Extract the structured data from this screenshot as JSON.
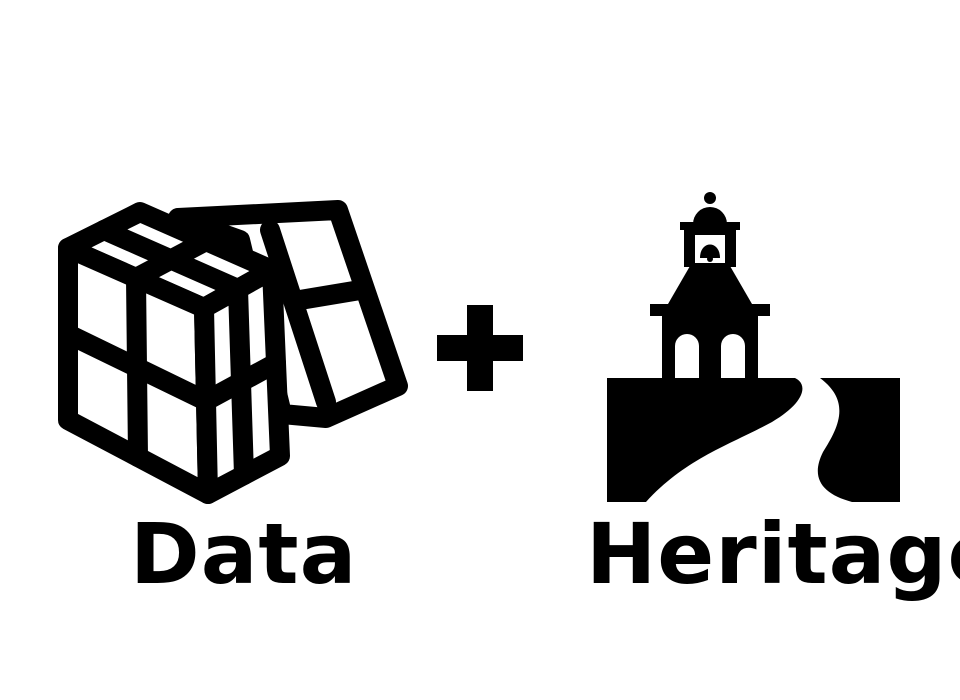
{
  "left_label": "Data",
  "right_label": "Heritage",
  "operator": "+",
  "icons": {
    "left": "cube-puzzle-icon",
    "right": "bell-tower-icon"
  },
  "colors": {
    "ink": "#000000",
    "background": "#ffffff"
  }
}
